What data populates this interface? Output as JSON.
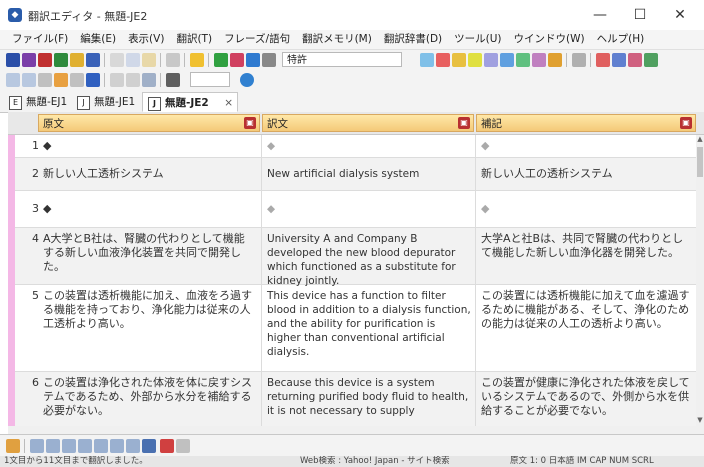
{
  "window": {
    "title": "翻訳エディタ - 無題-JE2",
    "minimize": "—",
    "maximize": "☐",
    "close": "✕"
  },
  "menu": [
    "ファイル(F)",
    "編集(E)",
    "表示(V)",
    "翻訳(T)",
    "フレーズ/語句",
    "翻訳メモリ(M)",
    "翻訳辞書(D)",
    "ツール(U)",
    "ウインドウ(W)",
    "ヘルプ(H)"
  ],
  "toolbar": {
    "field_value": "特許"
  },
  "tabs": [
    {
      "label": "無題-EJ1",
      "active": false
    },
    {
      "label": "無題-JE1",
      "active": false
    },
    {
      "label": "無題-JE2",
      "active": true
    }
  ],
  "columns": {
    "source": "原文",
    "translation": "訳文",
    "note": "補記"
  },
  "rows": [
    {
      "num": "1",
      "source": "◆",
      "translation": "◆",
      "note": "◆"
    },
    {
      "num": "2",
      "source": "新しい人工透析システム",
      "translation": "New artificial dialysis system",
      "note": "新しい人工の透析システム"
    },
    {
      "num": "3",
      "source": "◆",
      "translation": "◆",
      "note": "◆"
    },
    {
      "num": "4",
      "source": "A大学とB社は、腎臓の代わりとして機能する新しい血液浄化装置を共同で開発した。",
      "translation": "University A and Company B developed the new blood depurator which functioned as a substitute for kidney jointly.",
      "note": "大学Aと社Bは、共同で腎臓の代わりとして機能した新しい血浄化器を開発した。"
    },
    {
      "num": "5",
      "source": "この装置は透析機能に加え、血液をろ過する機能を持っており、浄化能力は従来の人工透析より高い。",
      "translation": "This device has a function to filter blood in addition to a dialysis function, and the ability for purification is higher than conventional artificial dialysis.",
      "note": "この装置には透析機能に加えて血を濾過するために機能がある、そして、浄化のための能力は従来の人工の透析より高い。"
    },
    {
      "num": "6",
      "source": "この装置は浄化された体液を体に戻すシステムであるため、外部から水分を補給する必要がない。",
      "translation": "Because this device is a system returning purified body fluid to health, it is not necessary to supply",
      "note": "この装置が健康に浄化された体液を戻しているシステムであるので、外側から水を供給することが必要でない。"
    }
  ],
  "status": {
    "message": "1文目から11文目まで翻訳しました。",
    "search": "Web検索 : Yahoo! Japan - サイト検索",
    "right": "原文   1:  0   日本語   IM   CAP NUM SCRL"
  }
}
